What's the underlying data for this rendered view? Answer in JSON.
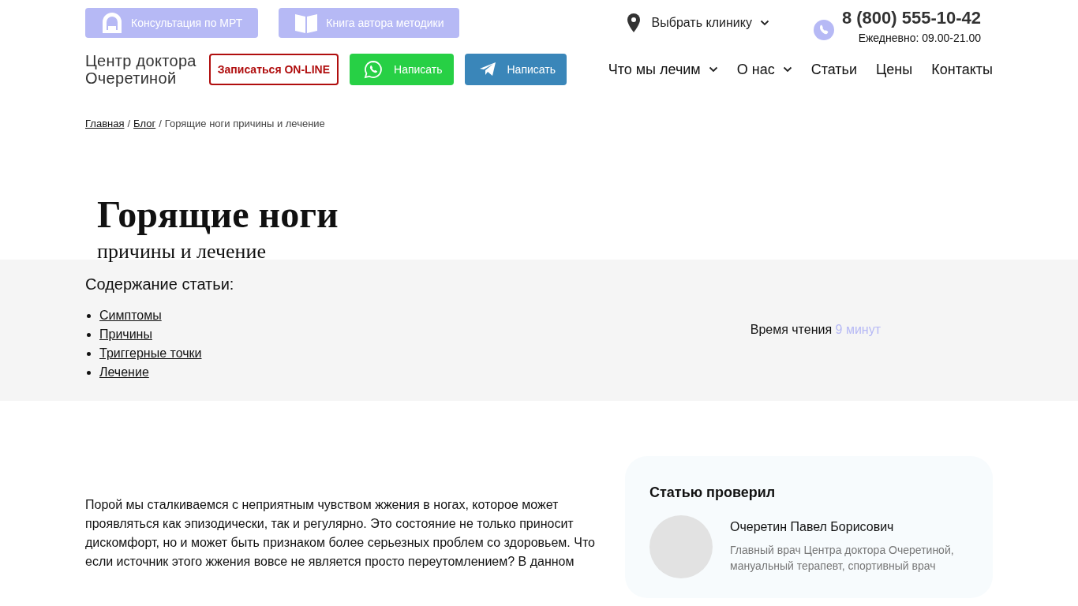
{
  "top_links": [
    {
      "kind": "mri",
      "label": "Консультация по МРТ"
    },
    {
      "kind": "book",
      "label": "Книга автора методики"
    }
  ],
  "logo": {
    "line_1": "Центр доктора",
    "line_2": "Очеретиной"
  },
  "clinic_select": {
    "label": "Выбрать клинику"
  },
  "phone": {
    "number": "8 (800) 555-10-42",
    "hours": "Ежедневно: 09.00-21.00"
  },
  "actions": [
    {
      "kind": "outline",
      "label": "Записаться ON-LINE"
    },
    {
      "kind": "whatsapp",
      "label": "Написать"
    },
    {
      "kind": "telegram",
      "label": "Написать"
    }
  ],
  "nav": [
    {
      "label": "Что мы лечим",
      "dropdown": true
    },
    {
      "label": "О нас",
      "dropdown": true
    },
    {
      "label": "Статьи",
      "dropdown": false
    },
    {
      "label": "Цены",
      "dropdown": false
    },
    {
      "label": "Контакты",
      "dropdown": false
    }
  ],
  "breadcrumbs": {
    "separator": "/",
    "items": [
      {
        "label": "Главная",
        "link": true
      },
      {
        "label": "Блог",
        "link": true
      },
      {
        "label": "Горящие ноги причины и лечение",
        "link": false
      }
    ]
  },
  "title": "Горящие ноги",
  "subtitle": "причины и лечение",
  "toc": {
    "heading": "Содержание статьи:",
    "items": [
      "Симптомы",
      "Причины",
      "Триггерные точки",
      "Лечение"
    ]
  },
  "reading_time": {
    "label": "Время чтения",
    "value": "9 минут"
  },
  "intro": "Порой мы сталкиваемся с неприятным чувством жжения в ногах, которое может проявляться как эпизодически, так и регулярно. Это состояние не только приносит дискомфорт, но и может быть признаком более серьезных проблем со здоровьем. Что если источник этого жжения вовсе не является просто переутомлением? В данном",
  "reviewer": {
    "heading": "Статью проверил",
    "name": "Очеретин Павел Борисович",
    "role": "Главный врач Центра доктора Очеретиной, мануальный терапевт, спортивный врач"
  }
}
